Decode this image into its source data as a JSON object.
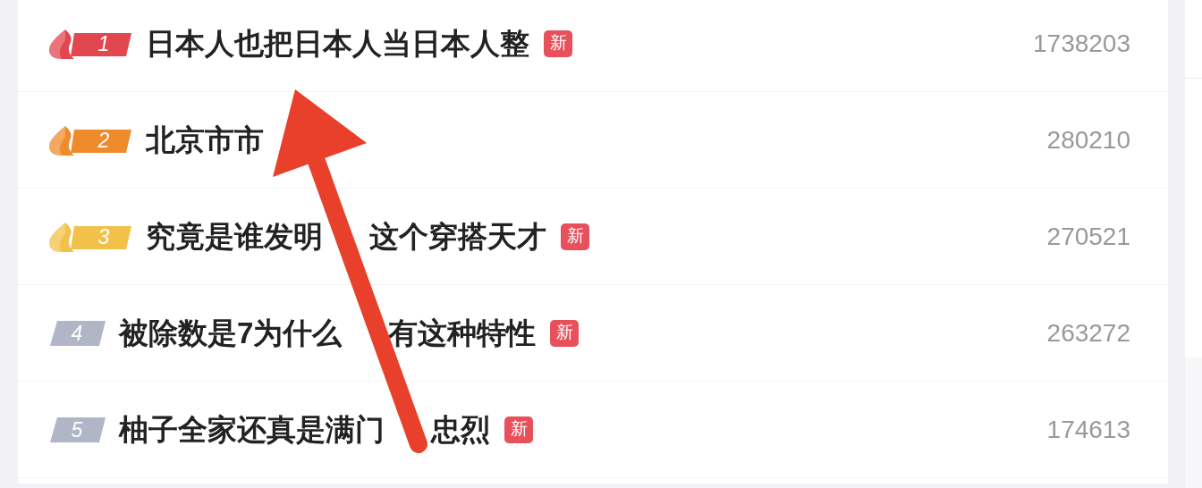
{
  "hot_list": [
    {
      "rank": "1",
      "kind": "hot",
      "color": "#e2474f",
      "title_segments": [
        "日本人也把日本人当日本人整"
      ],
      "is_new": true,
      "new_label": "新",
      "heat": "1738203"
    },
    {
      "rank": "2",
      "kind": "hot",
      "color": "#f08b2c",
      "title_segments": [
        "北京市市"
      ],
      "is_new": false,
      "heat": "280210"
    },
    {
      "rank": "3",
      "kind": "hot",
      "color": "#f2c14a",
      "title_segments": [
        "究竟是谁发明",
        "这个穿搭天才"
      ],
      "is_new": true,
      "new_label": "新",
      "heat": "270521"
    },
    {
      "rank": "4",
      "kind": "plain",
      "color": "#b1b6c6",
      "title_segments": [
        "被除数是7为什么",
        "有这种特性"
      ],
      "is_new": true,
      "new_label": "新",
      "heat": "263272"
    },
    {
      "rank": "5",
      "kind": "plain",
      "color": "#b1b6c6",
      "title_segments": [
        "柚子全家还真是满门",
        "忠烈"
      ],
      "is_new": true,
      "new_label": "新",
      "heat": "174613"
    }
  ]
}
